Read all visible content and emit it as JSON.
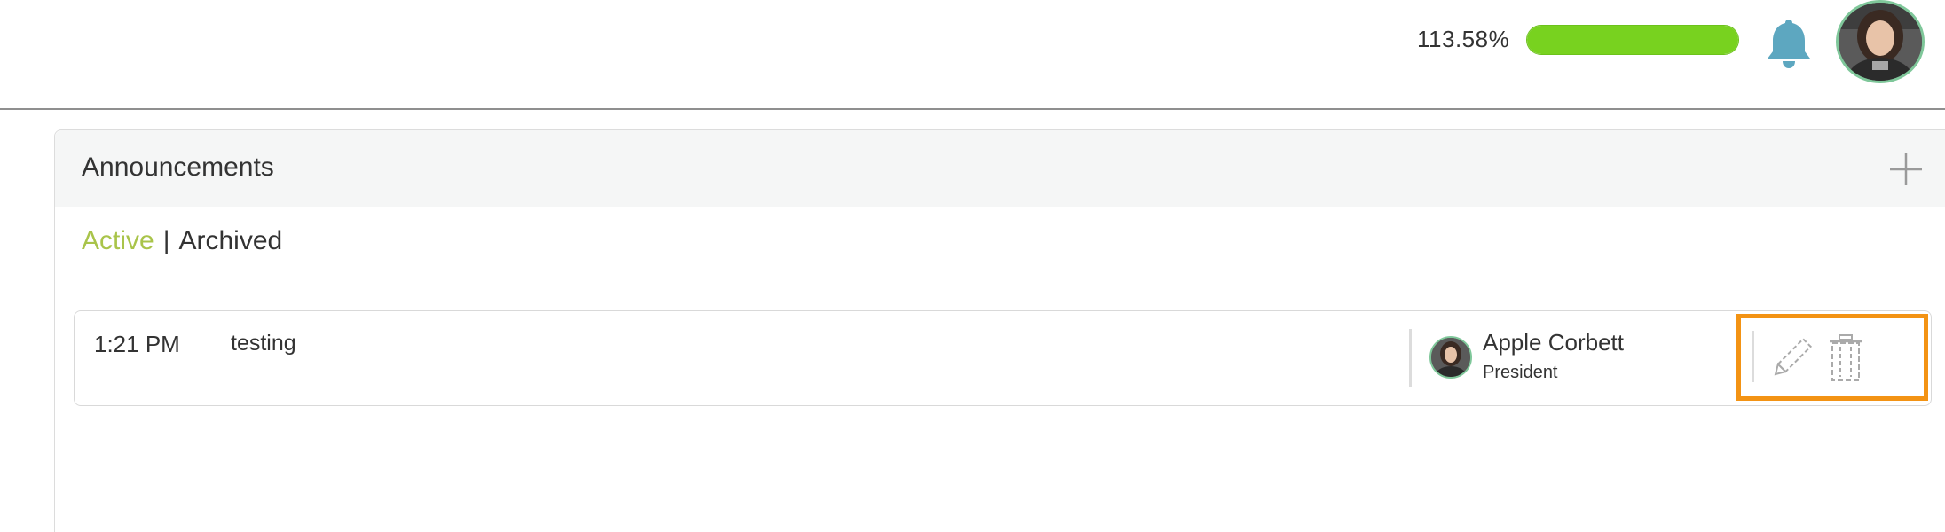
{
  "header": {
    "progress_label": "113.58%",
    "progress_value": 113.58,
    "progress_color": "#78d21f",
    "bell_icon": "bell-icon",
    "bell_color": "#5da7c0"
  },
  "panel": {
    "title": "Announcements",
    "add_icon": "plus-icon"
  },
  "tabs": {
    "active_label": "Active",
    "separator": "|",
    "archived_label": "Archived",
    "active_color": "#a9c44a"
  },
  "announcements": [
    {
      "time": "1:21 PM",
      "text": "testing",
      "author_name": "Apple Corbett",
      "author_role": "President",
      "edit_icon": "pencil-icon",
      "delete_icon": "trash-icon"
    }
  ],
  "highlight_color": "#f39314"
}
